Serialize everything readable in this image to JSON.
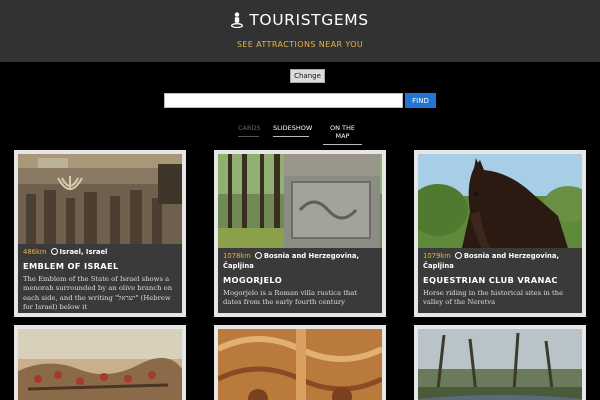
{
  "header": {
    "title": "TOURISTGEMS",
    "tagline": "SEE ATTRACTIONS NEAR YOU",
    "icon": "person-pin-icon"
  },
  "location": {
    "change_label": "Change"
  },
  "search": {
    "value": "",
    "placeholder": "",
    "find_label": "FIND"
  },
  "tabs": [
    {
      "label": "CARDS",
      "active": true
    },
    {
      "label": "SLIDESHOW",
      "active": false
    },
    {
      "label": "ON THE MAP",
      "active": false
    }
  ],
  "cards": [
    {
      "distance": "486km",
      "location": "Israel, Israel",
      "title": "EMBLEM OF ISRAEL",
      "description": "The Emblem of the State of Israel shows a menorah surrounded by an olive branch on each side, and the writing \"ישראל\" (Hebrew for Israel) below it"
    },
    {
      "distance": "1078km",
      "location": "Bosnia and Herzegovina, Čapljina",
      "title": "MOGORJELO",
      "description": "Mogorjelo is a Roman villa rustica that dates from the early fourth century"
    },
    {
      "distance": "1079km",
      "location": "Bosnia and Herzegovina, Čapljina",
      "title": "EQUESTRIAN CLUB VRANAC",
      "description": "Horse riding in the historical sites in the valley of the Neretva"
    },
    {
      "distance": "",
      "location": "",
      "title": "",
      "description": ""
    },
    {
      "distance": "",
      "location": "",
      "title": "",
      "description": ""
    },
    {
      "distance": "",
      "location": "",
      "title": "",
      "description": ""
    }
  ],
  "colors": {
    "accent": "#e8b14a",
    "find_button": "#2176d4",
    "header_bg": "#323232"
  }
}
